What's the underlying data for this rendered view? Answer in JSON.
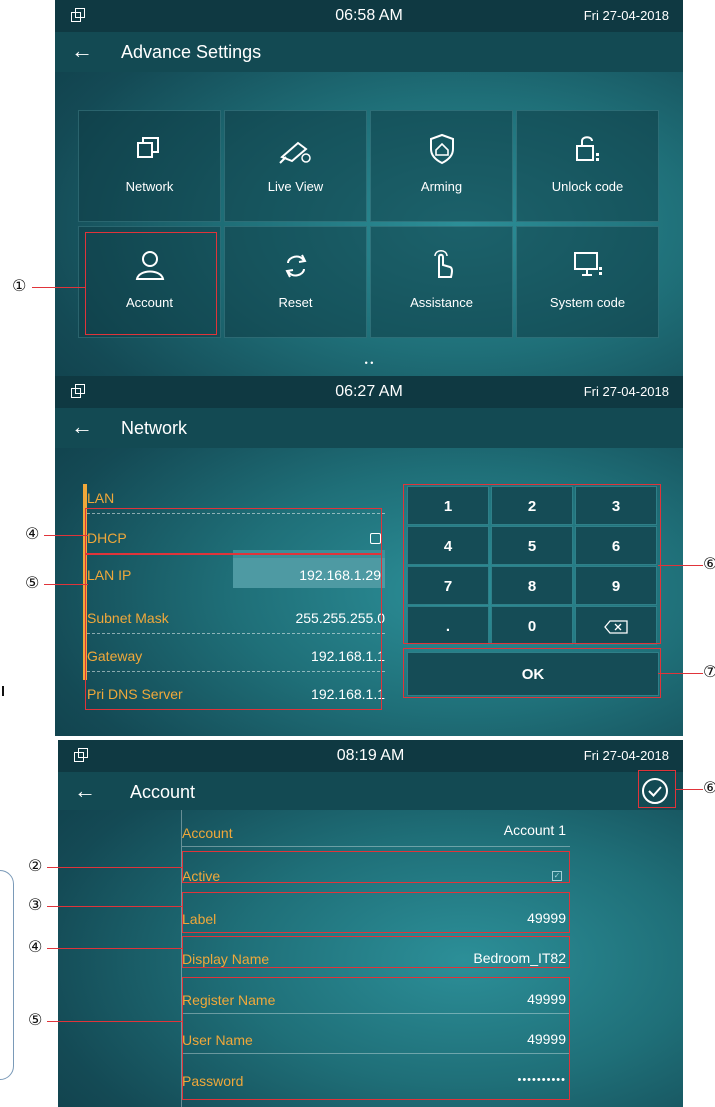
{
  "panel1": {
    "time": "06:58 AM",
    "date": "Fri   27-04-2018",
    "title": "Advance Settings",
    "tiles": [
      "Network",
      "Live View",
      "Arming",
      "Unlock code",
      "Account",
      "Reset",
      "Assistance",
      "System code"
    ],
    "page_dots": "•  •",
    "callout": "①"
  },
  "panel2": {
    "time": "06:27 AM",
    "date": "Fri   27-04-2018",
    "title": "Network",
    "rows": [
      {
        "label": "LAN",
        "value": ""
      },
      {
        "label": "DHCP",
        "value": ""
      },
      {
        "label": "LAN IP",
        "value": "192.168.1.29"
      },
      {
        "label": "Subnet Mask",
        "value": "255.255.255.0"
      },
      {
        "label": "Gateway",
        "value": "192.168.1.1"
      },
      {
        "label": "Pri DNS Server",
        "value": "192.168.1.1"
      }
    ],
    "keys": [
      "1",
      "2",
      "3",
      "4",
      "5",
      "6",
      "7",
      "8",
      "9",
      ".",
      "0"
    ],
    "ok": "OK",
    "callouts": {
      "c4": "④",
      "c5": "⑤",
      "c6": "⑥",
      "c7": "⑦"
    }
  },
  "panel3": {
    "time": "08:19 AM",
    "date": "Fri   27-04-2018",
    "title": "Account",
    "rows": [
      {
        "label": "Account",
        "value": "Account 1"
      },
      {
        "label": "Active",
        "value": ""
      },
      {
        "label": "Label",
        "value": "49999"
      },
      {
        "label": "Display Name",
        "value": "Bedroom_IT82"
      },
      {
        "label": "Register Name",
        "value": "49999"
      },
      {
        "label": "User Name",
        "value": "49999"
      },
      {
        "label": "Password",
        "value": "••••••••••"
      }
    ],
    "callouts": {
      "c2": "②",
      "c3": "③",
      "c4": "④",
      "c5": "⑤",
      "c6": "⑥"
    }
  },
  "colors": {
    "accent_orange": "#f0a83a",
    "annotation_red": "#e0343a",
    "header": "#134a53"
  }
}
